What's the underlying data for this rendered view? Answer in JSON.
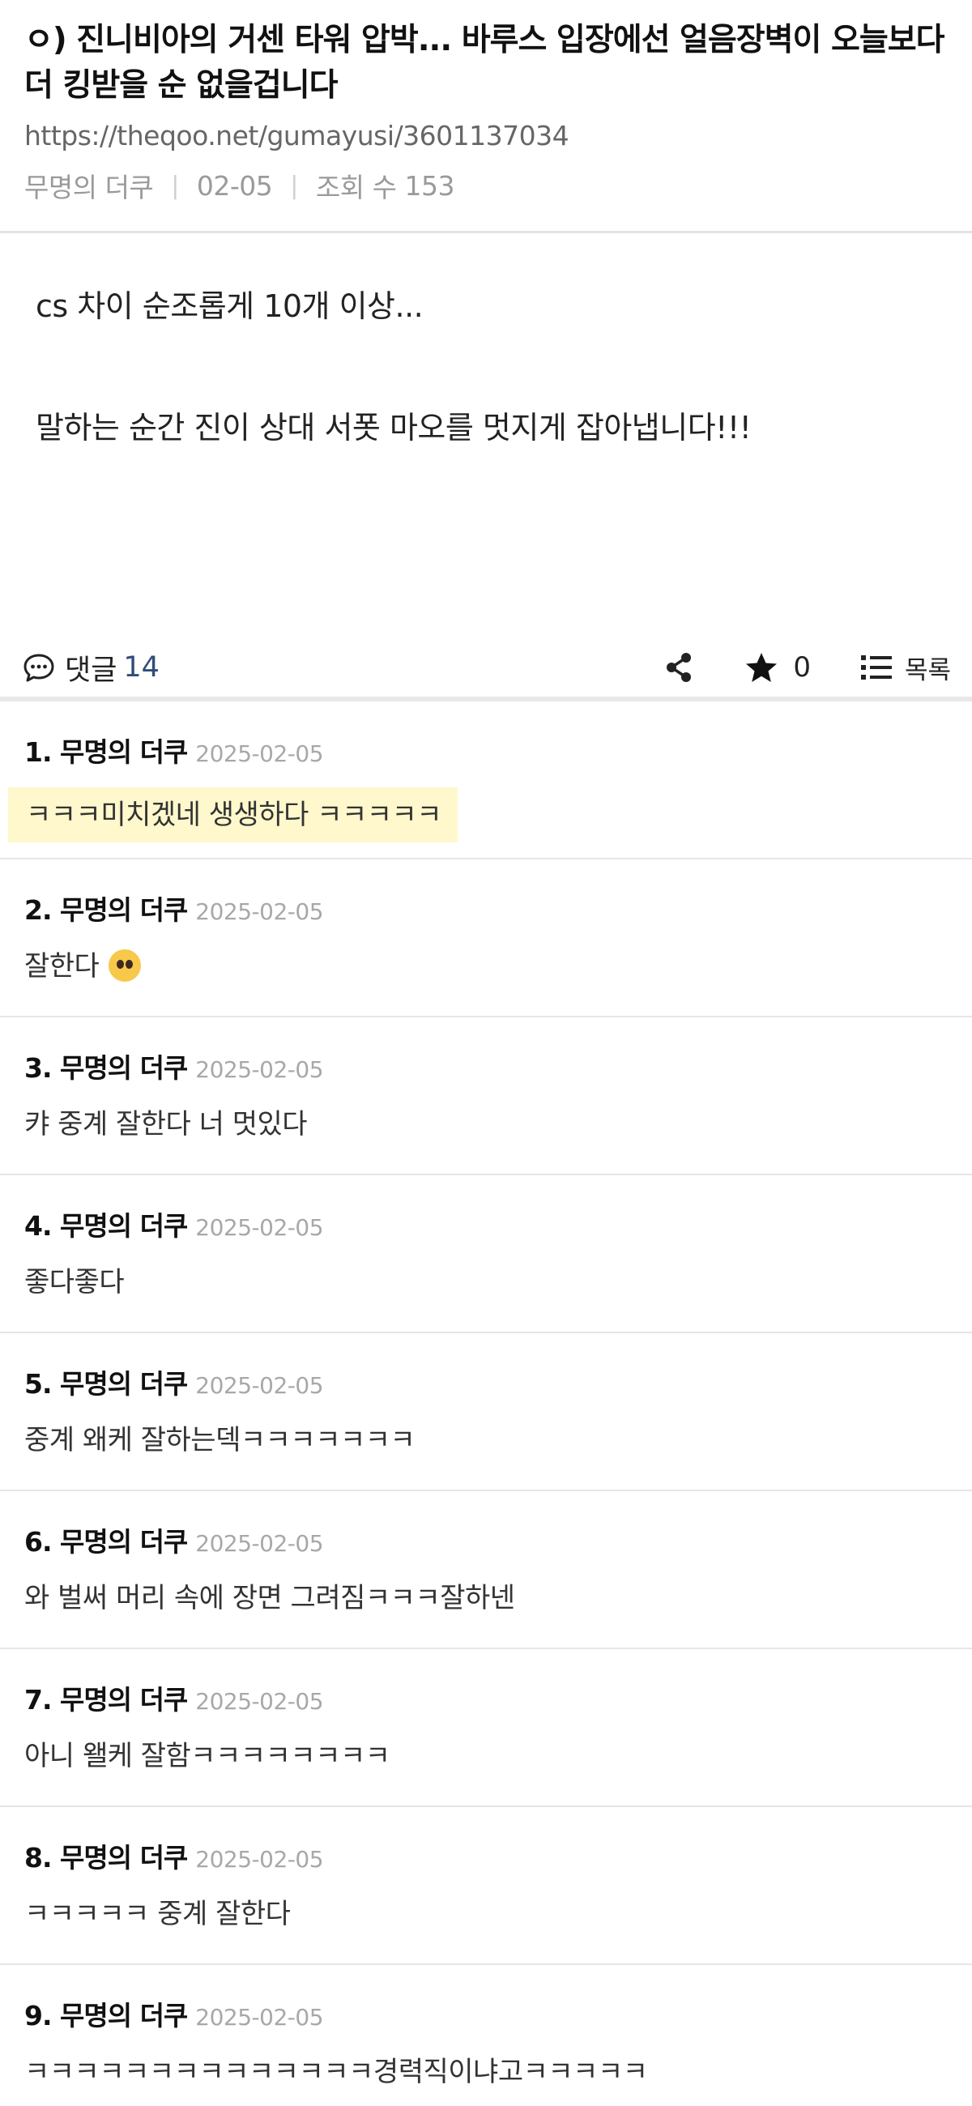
{
  "post": {
    "title": "ㅇ) 진니비아의 거센 타워 압박... 바루스 입장에선 얼음장벽이 오늘보다 더 킹받을 순 없을겁니다",
    "url": "https://theqoo.net/gumayusi/3601137034",
    "author": "무명의 더쿠",
    "date": "02-05",
    "views_label": "조회 수",
    "views": "153",
    "body": [
      "cs 차이 순조롭게 10개 이상...",
      "말하는 순간 진이 상대 서폿 마오를 멋지게 잡아냅니다!!!"
    ]
  },
  "actions": {
    "comment_label": "댓글",
    "comment_count": "14",
    "share_icon": "share-icon",
    "favorite_icon": "star-icon",
    "favorite_count": "0",
    "list_icon": "list-icon",
    "list_label": "목록"
  },
  "comments": [
    {
      "index": "1.",
      "author": "무명의 더쿠",
      "date": "2025-02-05",
      "text": "ㅋㅋㅋ미치겠네 생생하다 ㅋㅋㅋㅋㅋ",
      "highlighted": true
    },
    {
      "index": "2.",
      "author": "무명의 더쿠",
      "date": "2025-02-05",
      "text": "잘한다",
      "emoji": "pleading-face-emoji"
    },
    {
      "index": "3.",
      "author": "무명의 더쿠",
      "date": "2025-02-05",
      "text": "캬 중계 잘한다 너 멋있다"
    },
    {
      "index": "4.",
      "author": "무명의 더쿠",
      "date": "2025-02-05",
      "text": "좋다좋다"
    },
    {
      "index": "5.",
      "author": "무명의 더쿠",
      "date": "2025-02-05",
      "text": "중계 왜케 잘하는덱ㅋㅋㅋㅋㅋㅋㅋ"
    },
    {
      "index": "6.",
      "author": "무명의 더쿠",
      "date": "2025-02-05",
      "text": "와 벌써 머리 속에 장면 그려짐ㅋㅋㅋ잘하넨"
    },
    {
      "index": "7.",
      "author": "무명의 더쿠",
      "date": "2025-02-05",
      "text": "아니 왤케 잘함ㅋㅋㅋㅋㅋㅋㅋㅋ"
    },
    {
      "index": "8.",
      "author": "무명의 더쿠",
      "date": "2025-02-05",
      "text": "ㅋㅋㅋㅋㅋ 중계 잘한다"
    },
    {
      "index": "9.",
      "author": "무명의 더쿠",
      "date": "2025-02-05",
      "text": "ㅋㅋㅋㅋㅋㅋㅋㅋㅋㅋㅋㅋㅋㅋ경력직이냐고ㅋㅋㅋㅋㅋ"
    }
  ],
  "colors": {
    "comment_count": "#2f4d7a",
    "highlight": "#fef8cc",
    "meta": "#9a9a9a"
  }
}
